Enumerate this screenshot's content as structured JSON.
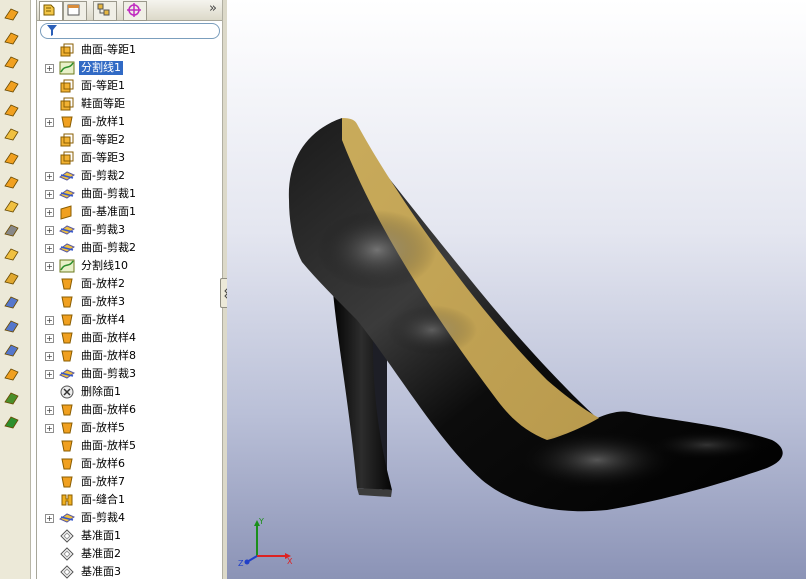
{
  "toolbar": {
    "icons": [
      "extruded-surface-icon",
      "revolved-surface-icon",
      "swept-surface-icon",
      "lofted-surface-icon",
      "boundary-surface-icon",
      "planar-surface-icon",
      "offset-surface-icon",
      "ruled-surface-icon",
      "fill-surface-icon",
      "delete-face-icon",
      "knit-surface-icon",
      "thicken-icon",
      "trim-surface-icon",
      "untrim-surface-icon",
      "extend-surface-icon",
      "replace-face-icon",
      "move-face-icon",
      "split-line-icon"
    ]
  },
  "feature_manager": {
    "tabs": [
      "featuremanager-tab",
      "propertymanager-tab",
      "configurationmanager-tab",
      "dimxpert-tab"
    ],
    "more": "»",
    "items": [
      {
        "label": "曲面-等距1",
        "icon": "offset-surface-icon",
        "expandable": false,
        "selected": false
      },
      {
        "label": "分割线1",
        "icon": "split-line-icon",
        "expandable": true,
        "selected": true
      },
      {
        "label": "面-等距1",
        "icon": "offset-surface-icon",
        "expandable": false,
        "selected": false
      },
      {
        "label": "鞋面等距",
        "icon": "offset-surface-icon",
        "expandable": false,
        "selected": false
      },
      {
        "label": "面-放样1",
        "icon": "loft-icon",
        "expandable": true,
        "selected": false
      },
      {
        "label": "面-等距2",
        "icon": "offset-surface-icon",
        "expandable": false,
        "selected": false
      },
      {
        "label": "面-等距3",
        "icon": "offset-surface-icon",
        "expandable": false,
        "selected": false
      },
      {
        "label": "面-剪裁2",
        "icon": "trim-surface-icon",
        "expandable": true,
        "selected": false
      },
      {
        "label": "曲面-剪裁1",
        "icon": "trim-surface-icon",
        "expandable": true,
        "selected": false
      },
      {
        "label": "面-基准面1",
        "icon": "planar-surface-icon",
        "expandable": true,
        "selected": false
      },
      {
        "label": "面-剪裁3",
        "icon": "trim-surface-icon",
        "expandable": true,
        "selected": false
      },
      {
        "label": "曲面-剪裁2",
        "icon": "trim-surface-icon",
        "expandable": true,
        "selected": false
      },
      {
        "label": "分割线10",
        "icon": "split-line-icon",
        "expandable": true,
        "selected": false
      },
      {
        "label": "面-放样2",
        "icon": "loft-icon",
        "expandable": false,
        "selected": false
      },
      {
        "label": "面-放样3",
        "icon": "loft-icon",
        "expandable": false,
        "selected": false
      },
      {
        "label": "面-放样4",
        "icon": "loft-icon",
        "expandable": true,
        "selected": false
      },
      {
        "label": "曲面-放样4",
        "icon": "loft-icon",
        "expandable": true,
        "selected": false
      },
      {
        "label": "曲面-放样8",
        "icon": "loft-icon",
        "expandable": true,
        "selected": false
      },
      {
        "label": "曲面-剪裁3",
        "icon": "trim-surface-icon",
        "expandable": true,
        "selected": false
      },
      {
        "label": "删除面1",
        "icon": "delete-face-icon",
        "expandable": false,
        "selected": false
      },
      {
        "label": "曲面-放样6",
        "icon": "loft-icon",
        "expandable": true,
        "selected": false
      },
      {
        "label": "面-放样5",
        "icon": "loft-icon",
        "expandable": true,
        "selected": false
      },
      {
        "label": "曲面-放样5",
        "icon": "loft-icon",
        "expandable": false,
        "selected": false
      },
      {
        "label": "面-放样6",
        "icon": "loft-icon",
        "expandable": false,
        "selected": false
      },
      {
        "label": "面-放样7",
        "icon": "loft-icon",
        "expandable": false,
        "selected": false
      },
      {
        "label": "面-缝合1",
        "icon": "knit-surface-icon",
        "expandable": false,
        "selected": false
      },
      {
        "label": "面-剪裁4",
        "icon": "trim-surface-icon",
        "expandable": true,
        "selected": false
      },
      {
        "label": "基准面1",
        "icon": "reference-plane-icon",
        "expandable": false,
        "selected": false
      },
      {
        "label": "基准面2",
        "icon": "reference-plane-icon",
        "expandable": false,
        "selected": false
      },
      {
        "label": "基准面3",
        "icon": "reference-plane-icon",
        "expandable": false,
        "selected": false
      }
    ]
  },
  "viewport": {
    "model": "high-heel-shoe-model",
    "triad_axes": [
      "Y",
      "X",
      "Z"
    ]
  },
  "colors": {
    "selection": "#316ac5",
    "shoe_body": "#0a0a0a",
    "shoe_lining": "#c9ab5b"
  }
}
